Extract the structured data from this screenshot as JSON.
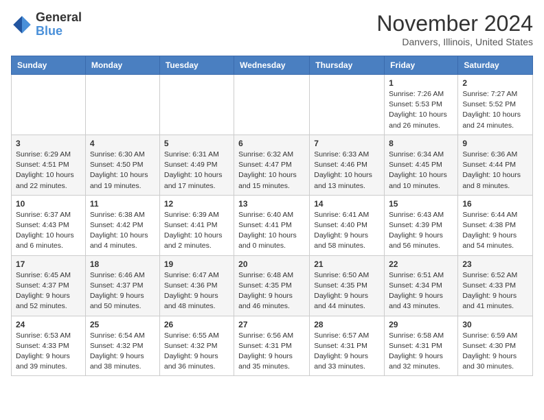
{
  "logo": {
    "general": "General",
    "blue": "Blue"
  },
  "title": "November 2024",
  "location": "Danvers, Illinois, United States",
  "days_header": [
    "Sunday",
    "Monday",
    "Tuesday",
    "Wednesday",
    "Thursday",
    "Friday",
    "Saturday"
  ],
  "weeks": [
    [
      {
        "day": "",
        "info": ""
      },
      {
        "day": "",
        "info": ""
      },
      {
        "day": "",
        "info": ""
      },
      {
        "day": "",
        "info": ""
      },
      {
        "day": "",
        "info": ""
      },
      {
        "day": "1",
        "info": "Sunrise: 7:26 AM\nSunset: 5:53 PM\nDaylight: 10 hours and 26 minutes."
      },
      {
        "day": "2",
        "info": "Sunrise: 7:27 AM\nSunset: 5:52 PM\nDaylight: 10 hours and 24 minutes."
      }
    ],
    [
      {
        "day": "3",
        "info": "Sunrise: 6:29 AM\nSunset: 4:51 PM\nDaylight: 10 hours and 22 minutes."
      },
      {
        "day": "4",
        "info": "Sunrise: 6:30 AM\nSunset: 4:50 PM\nDaylight: 10 hours and 19 minutes."
      },
      {
        "day": "5",
        "info": "Sunrise: 6:31 AM\nSunset: 4:49 PM\nDaylight: 10 hours and 17 minutes."
      },
      {
        "day": "6",
        "info": "Sunrise: 6:32 AM\nSunset: 4:47 PM\nDaylight: 10 hours and 15 minutes."
      },
      {
        "day": "7",
        "info": "Sunrise: 6:33 AM\nSunset: 4:46 PM\nDaylight: 10 hours and 13 minutes."
      },
      {
        "day": "8",
        "info": "Sunrise: 6:34 AM\nSunset: 4:45 PM\nDaylight: 10 hours and 10 minutes."
      },
      {
        "day": "9",
        "info": "Sunrise: 6:36 AM\nSunset: 4:44 PM\nDaylight: 10 hours and 8 minutes."
      }
    ],
    [
      {
        "day": "10",
        "info": "Sunrise: 6:37 AM\nSunset: 4:43 PM\nDaylight: 10 hours and 6 minutes."
      },
      {
        "day": "11",
        "info": "Sunrise: 6:38 AM\nSunset: 4:42 PM\nDaylight: 10 hours and 4 minutes."
      },
      {
        "day": "12",
        "info": "Sunrise: 6:39 AM\nSunset: 4:41 PM\nDaylight: 10 hours and 2 minutes."
      },
      {
        "day": "13",
        "info": "Sunrise: 6:40 AM\nSunset: 4:41 PM\nDaylight: 10 hours and 0 minutes."
      },
      {
        "day": "14",
        "info": "Sunrise: 6:41 AM\nSunset: 4:40 PM\nDaylight: 9 hours and 58 minutes."
      },
      {
        "day": "15",
        "info": "Sunrise: 6:43 AM\nSunset: 4:39 PM\nDaylight: 9 hours and 56 minutes."
      },
      {
        "day": "16",
        "info": "Sunrise: 6:44 AM\nSunset: 4:38 PM\nDaylight: 9 hours and 54 minutes."
      }
    ],
    [
      {
        "day": "17",
        "info": "Sunrise: 6:45 AM\nSunset: 4:37 PM\nDaylight: 9 hours and 52 minutes."
      },
      {
        "day": "18",
        "info": "Sunrise: 6:46 AM\nSunset: 4:37 PM\nDaylight: 9 hours and 50 minutes."
      },
      {
        "day": "19",
        "info": "Sunrise: 6:47 AM\nSunset: 4:36 PM\nDaylight: 9 hours and 48 minutes."
      },
      {
        "day": "20",
        "info": "Sunrise: 6:48 AM\nSunset: 4:35 PM\nDaylight: 9 hours and 46 minutes."
      },
      {
        "day": "21",
        "info": "Sunrise: 6:50 AM\nSunset: 4:35 PM\nDaylight: 9 hours and 44 minutes."
      },
      {
        "day": "22",
        "info": "Sunrise: 6:51 AM\nSunset: 4:34 PM\nDaylight: 9 hours and 43 minutes."
      },
      {
        "day": "23",
        "info": "Sunrise: 6:52 AM\nSunset: 4:33 PM\nDaylight: 9 hours and 41 minutes."
      }
    ],
    [
      {
        "day": "24",
        "info": "Sunrise: 6:53 AM\nSunset: 4:33 PM\nDaylight: 9 hours and 39 minutes."
      },
      {
        "day": "25",
        "info": "Sunrise: 6:54 AM\nSunset: 4:32 PM\nDaylight: 9 hours and 38 minutes."
      },
      {
        "day": "26",
        "info": "Sunrise: 6:55 AM\nSunset: 4:32 PM\nDaylight: 9 hours and 36 minutes."
      },
      {
        "day": "27",
        "info": "Sunrise: 6:56 AM\nSunset: 4:31 PM\nDaylight: 9 hours and 35 minutes."
      },
      {
        "day": "28",
        "info": "Sunrise: 6:57 AM\nSunset: 4:31 PM\nDaylight: 9 hours and 33 minutes."
      },
      {
        "day": "29",
        "info": "Sunrise: 6:58 AM\nSunset: 4:31 PM\nDaylight: 9 hours and 32 minutes."
      },
      {
        "day": "30",
        "info": "Sunrise: 6:59 AM\nSunset: 4:30 PM\nDaylight: 9 hours and 30 minutes."
      }
    ]
  ]
}
